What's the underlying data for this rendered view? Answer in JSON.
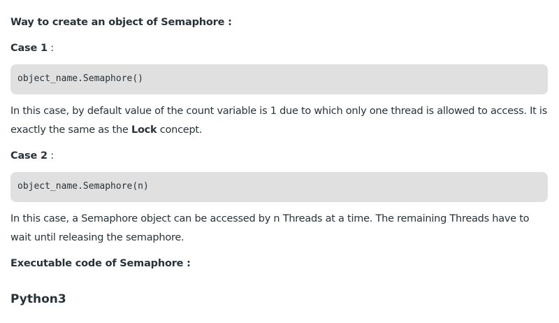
{
  "article": {
    "section_heading": "Way to create an object of Semaphore :",
    "case1": {
      "label": "Case 1",
      "suffix": " :",
      "code": "object_name.Semaphore()",
      "desc_before": "In this case, by default value of the count variable is 1 due to which only one thread is allowed to access. It is exactly the same as the ",
      "desc_bold": "Lock",
      "desc_after": " concept."
    },
    "case2": {
      "label": "Case 2",
      "suffix": " :",
      "code": "object_name.Semaphore(n)",
      "desc": "In this case, a Semaphore object can be accessed by n Threads at a time. The remaining Threads have to wait until releasing the semaphore."
    },
    "executable_heading": "Executable code of Semaphore :",
    "language_tab": "Python3"
  },
  "colors": {
    "text": "#273239",
    "code_background": "#e0e0e0"
  }
}
